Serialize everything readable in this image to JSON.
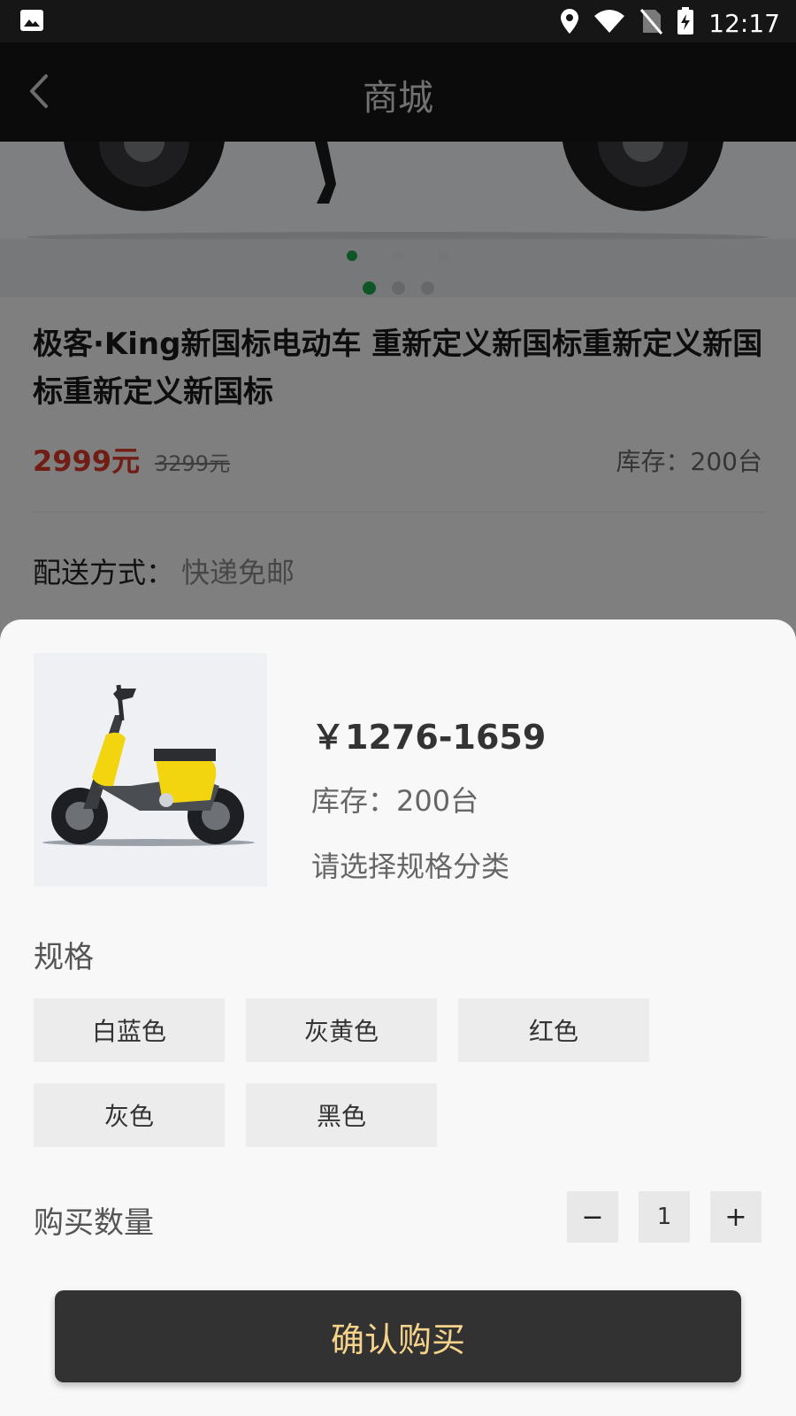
{
  "status_bar": {
    "time": "12:17"
  },
  "header": {
    "title": "商城"
  },
  "product": {
    "title": "极客·King新国标电动车  重新定义新国标重新定义新国标重新定义新国标",
    "price": "2999元",
    "original_price": "3299元",
    "stock": "库存：200台",
    "delivery_label": "配送方式：",
    "delivery_value": "快递免邮"
  },
  "sheet": {
    "price_range": "￥1276-1659",
    "stock": "库存：200台",
    "hint": "请选择规格分类",
    "spec_label": "规格",
    "spec_options": [
      "白蓝色",
      "灰黄色",
      "红色",
      "灰色",
      "黑色"
    ],
    "qty_label": "购买数量",
    "qty_minus": "−",
    "qty_value": "1",
    "qty_plus": "+",
    "confirm_label": "确认购买"
  },
  "colors": {
    "price_red": "#d9392b",
    "accent_green": "#1fa34a",
    "confirm_text": "#f5d38a",
    "confirm_bg": "#323232"
  }
}
